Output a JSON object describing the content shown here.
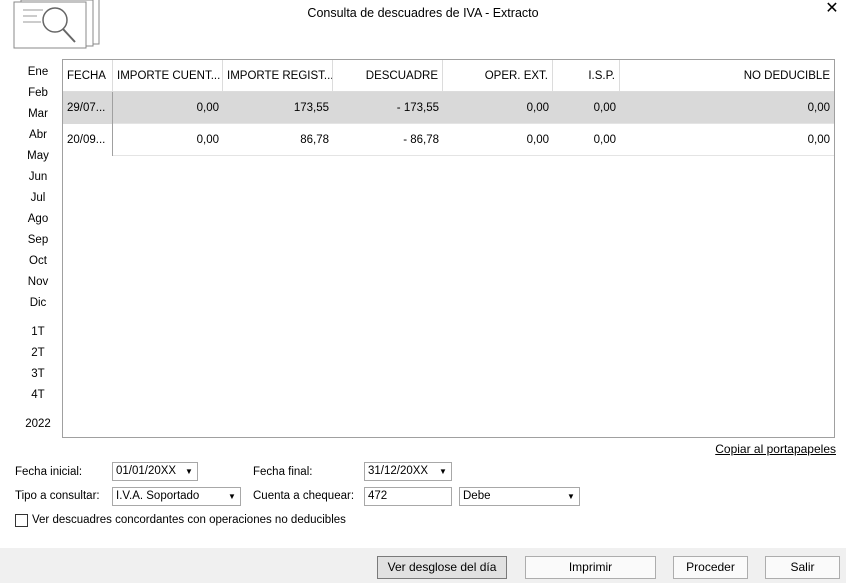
{
  "window": {
    "title": "Consulta de descuadres de IVA - Extracto",
    "close_glyph": "✕"
  },
  "months": [
    "Ene",
    "Feb",
    "Mar",
    "Abr",
    "May",
    "Jun",
    "Jul",
    "Ago",
    "Sep",
    "Oct",
    "Nov",
    "Dic"
  ],
  "quarters": [
    "1T",
    "2T",
    "3T",
    "4T"
  ],
  "year": "2022",
  "table": {
    "columns": [
      "FECHA",
      "IMPORTE CUENT...",
      "IMPORTE REGIST...",
      "DESCUADRE",
      "OPER. EXT.",
      "I.S.P.",
      "NO DEDUCIBLE"
    ],
    "rows": [
      [
        "29/07...",
        "0,00",
        "173,55",
        "- 173,55",
        "0,00",
        "0,00",
        "0,00"
      ],
      [
        "20/09...",
        "0,00",
        "86,78",
        "- 86,78",
        "0,00",
        "0,00",
        "0,00"
      ]
    ]
  },
  "copy_link": "Copiar al portapapeles",
  "form": {
    "fecha_inicial_label": "Fecha inicial:",
    "fecha_inicial_value": "01/01/20XX",
    "fecha_final_label": "Fecha final:",
    "fecha_final_value": "31/12/20XX",
    "tipo_label": "Tipo a consultar:",
    "tipo_value": "I.V.A. Soportado",
    "cuenta_label": "Cuenta a chequear:",
    "cuenta_value": "472",
    "debe_value": "Debe",
    "checkbox_label": "Ver descuadres concordantes con operaciones no deducibles"
  },
  "buttons": {
    "desglose": "Ver desglose del día",
    "imprimir": "Imprimir",
    "proceder": "Proceder",
    "salir": "Salir"
  }
}
